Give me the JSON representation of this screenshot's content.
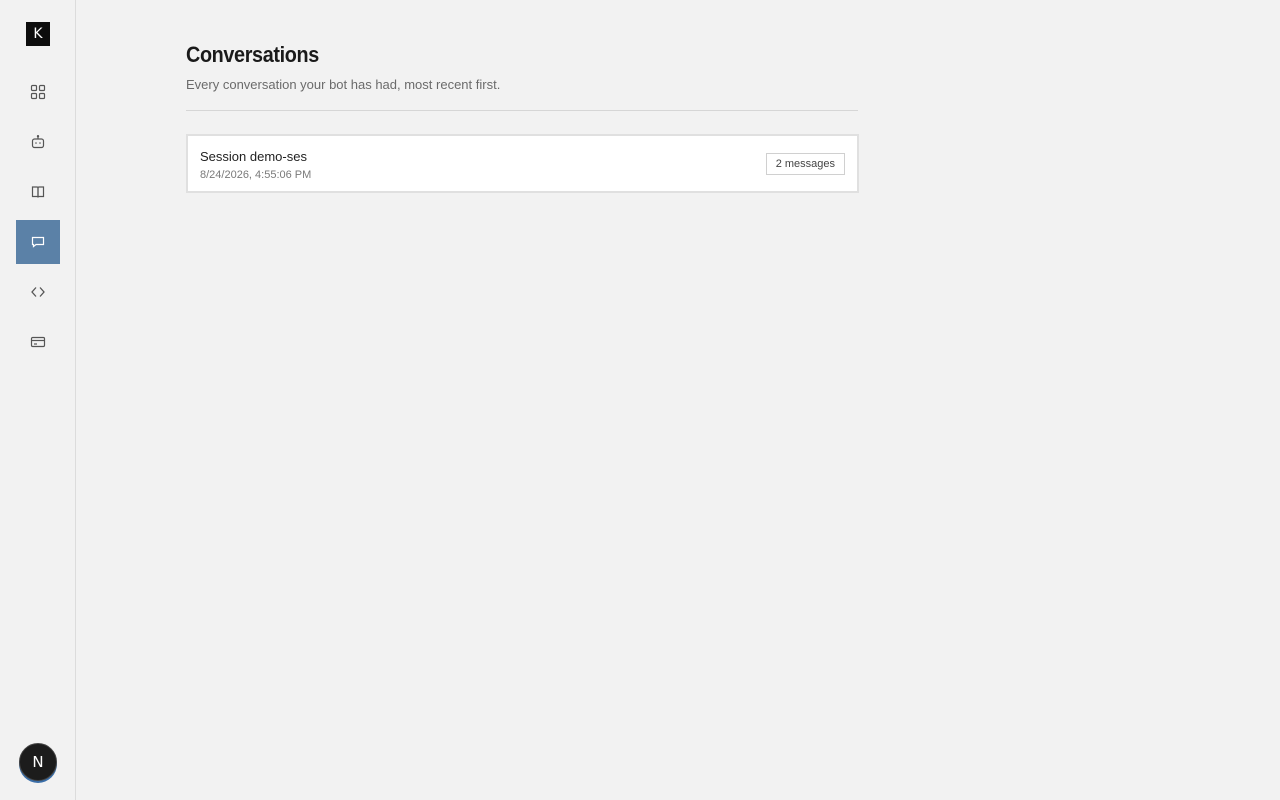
{
  "brand": {
    "logo_letter": "K"
  },
  "sidebar": {
    "items": [
      {
        "icon": "dashboard-grid-icon",
        "active": false
      },
      {
        "icon": "bot-icon",
        "active": false
      },
      {
        "icon": "book-icon",
        "active": false
      },
      {
        "icon": "chat-bubble-icon",
        "active": true
      },
      {
        "icon": "code-brackets-icon",
        "active": false
      },
      {
        "icon": "credit-card-icon",
        "active": false
      }
    ],
    "active_color": "#5b81a7"
  },
  "user": {
    "avatar_initial": "N"
  },
  "page": {
    "title": "Conversations",
    "subtitle": "Every conversation your bot has had, most recent first."
  },
  "conversations": [
    {
      "title": "Session demo-ses",
      "timestamp": "8/24/2026, 4:55:06 PM",
      "message_count": "2 messages"
    }
  ]
}
